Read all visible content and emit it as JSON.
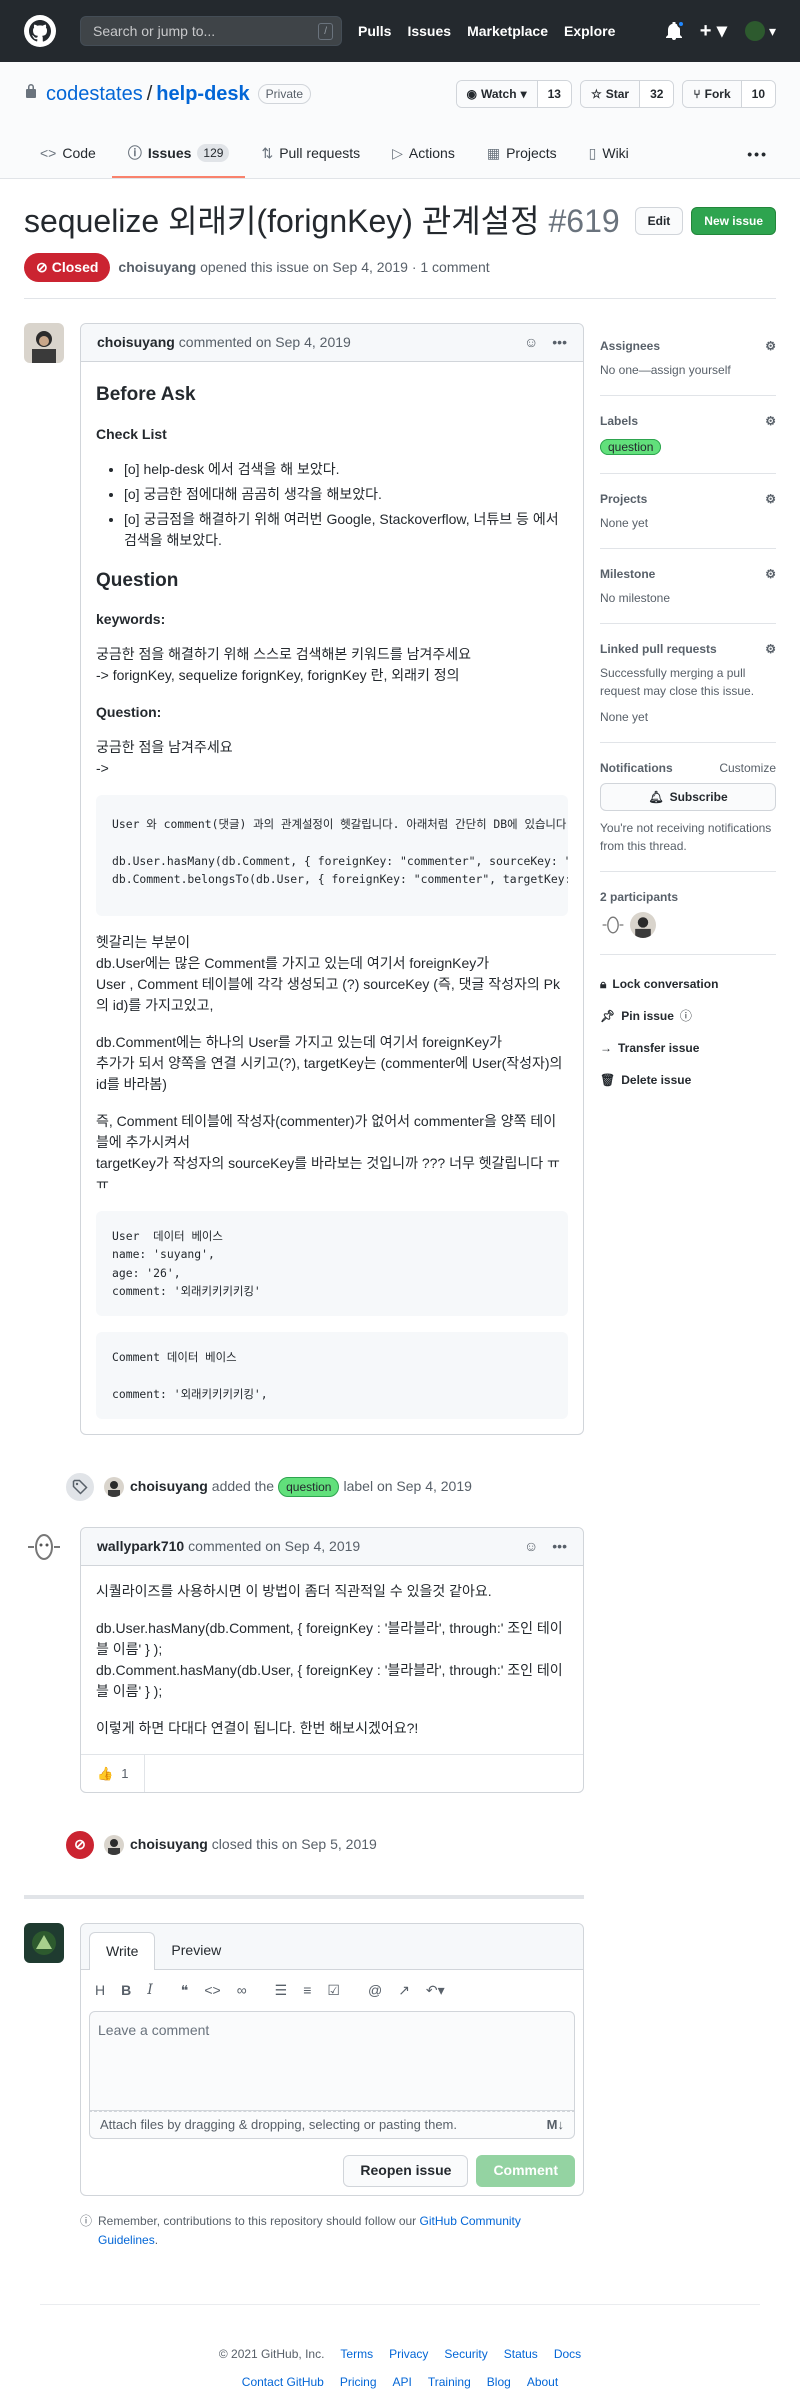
{
  "header": {
    "search_placeholder": "Search or jump to...",
    "search_key": "/",
    "nav": [
      "Pulls",
      "Issues",
      "Marketplace",
      "Explore"
    ]
  },
  "repo": {
    "owner": "codestates",
    "sep": "/",
    "name": "help-desk",
    "visibility": "Private",
    "watch_label": "Watch",
    "watch_count": "13",
    "star_label": "Star",
    "star_count": "32",
    "fork_label": "Fork",
    "fork_count": "10",
    "tabs": [
      {
        "label": "Code"
      },
      {
        "label": "Issues",
        "count": "129"
      },
      {
        "label": "Pull requests"
      },
      {
        "label": "Actions"
      },
      {
        "label": "Projects"
      },
      {
        "label": "Wiki"
      }
    ]
  },
  "issue": {
    "title": "sequelize 외래키(forignKey) 관계설정",
    "number": "#619",
    "edit_label": "Edit",
    "new_issue_label": "New issue",
    "state": "Closed",
    "meta_author": "choisuyang",
    "meta_text": "opened this issue on Sep 4, 2019 · 1 comment"
  },
  "comment1": {
    "author": "choisuyang",
    "date": "commented on Sep 4, 2019",
    "h_before": "Before Ask",
    "h_check": "Check List",
    "checks": [
      "[o] help-desk 에서 검색을 해 보았다.",
      "[o] 궁금한 점에대해 곰곰히 생각을 해보았다.",
      "[o] 궁금점을 해결하기 위해 여러번 Google, Stackoverflow, 너튜브 등 에서 검색을 해보았다."
    ],
    "h_question": "Question",
    "h_keywords": "keywords:",
    "keywords_p1": "궁금한 점을 해결하기 위해 스스로 검색해본 키워드를 남겨주세요",
    "keywords_p2": "-> forignKey, sequelize forignKey, forignKey 란, 외래키 정의",
    "h_question2": "Question:",
    "question_p1": "궁금한 점을 남겨주세요",
    "question_p2": "->",
    "code1": "User 와 comment(댓글) 과의 관계설정이 헷갈립니다. 아래처럼 간단히 DB에 있습니다\n\ndb.User.hasMany(db.Comment, { foreignKey: \"commenter\", sourceKey: \"id\" });\ndb.Comment.belongsTo(db.User, { foreignKey: \"commenter\", targetKey: \"id\" });",
    "para1": "헷갈리는 부분이\ndb.User에는 많은 Comment를 가지고 있는데 여기서 foreignKey가\nUser , Comment 테이블에 각각 생성되고 (?) sourceKey (즉, 댓글 작성자의 Pk의 id)를 가지고있고,",
    "para2": "db.Comment에는 하나의 User를 가지고 있는데 여기서 foreignKey가\n추가가 되서 양쪽을 연결 시키고(?), targetKey는 (commenter에 User(작성자)의 id를 바라봄)",
    "para3": "즉, Comment 테이블에 작성자(commenter)가 없어서 commenter을 양쪽 테이블에 추가시켜서\ntargetKey가 작성자의 sourceKey를 바라보는 것입니까 ??? 너무 헷갈립니다 ㅠㅠ",
    "code2": "User  데이터 베이스\nname: 'suyang',\nage: '26',\ncomment: '외래키키키키킹'",
    "code3": "Comment 데이터 베이스\n\ncomment: '외래키키키키킹',"
  },
  "event_label": {
    "actor": "choisuyang",
    "pre": "added the",
    "label": "question",
    "post": "label on Sep 4, 2019"
  },
  "comment2": {
    "author": "wallypark710",
    "date": "commented on Sep 4, 2019",
    "p1": "시퀄라이즈를 사용하시면 이 방법이 좀더 직관적일 수 있을것 같아요.",
    "p2": "db.User.hasMany(db.Comment, { foreignKey : '블라블라', through:' 조인 테이블 이름' } );\ndb.Comment.hasMany(db.User, { foreignKey : '블라블라', through:' 조인 테이블 이름' } );",
    "p3": "이렇게 하면 다대다 연결이 됩니다. 한번 해보시겠어요?!",
    "reaction_emoji": "👍",
    "reaction_count": "1"
  },
  "event_closed": {
    "actor": "choisuyang",
    "text": "closed this on Sep 5, 2019"
  },
  "new_comment": {
    "tab_write": "Write",
    "tab_preview": "Preview",
    "placeholder": "Leave a comment",
    "attach_text": "Attach files by dragging & dropping, selecting or pasting them.",
    "reopen_label": "Reopen issue",
    "comment_label": "Comment",
    "note_pre": "Remember, contributions to this repository should follow our",
    "note_link": "GitHub Community Guidelines",
    "note_post": "."
  },
  "sidebar": {
    "assignees_h": "Assignees",
    "assignees_v": "No one—assign yourself",
    "labels_h": "Labels",
    "labels_v": "question",
    "projects_h": "Projects",
    "projects_v": "None yet",
    "milestone_h": "Milestone",
    "milestone_v": "No milestone",
    "linked_h": "Linked pull requests",
    "linked_desc": "Successfully merging a pull request may close this issue.",
    "linked_v": "None yet",
    "notif_h": "Notifications",
    "notif_customize": "Customize",
    "subscribe": "Subscribe",
    "notif_desc": "You're not receiving notifications from this thread.",
    "participants_h": "2 participants",
    "lock": "Lock conversation",
    "pin": "Pin issue",
    "transfer": "Transfer issue",
    "delete": "Delete issue"
  },
  "footer": {
    "copyright": "© 2021 GitHub, Inc.",
    "row1": [
      "Terms",
      "Privacy",
      "Security",
      "Status",
      "Docs"
    ],
    "row2": [
      "Contact GitHub",
      "Pricing",
      "API",
      "Training",
      "Blog",
      "About"
    ]
  },
  "colors": {
    "header_bg": "#24292e",
    "closed_red": "#cb2431",
    "green": "#2ea44f",
    "tab_accent": "#f9826c",
    "link": "#0366d6"
  }
}
